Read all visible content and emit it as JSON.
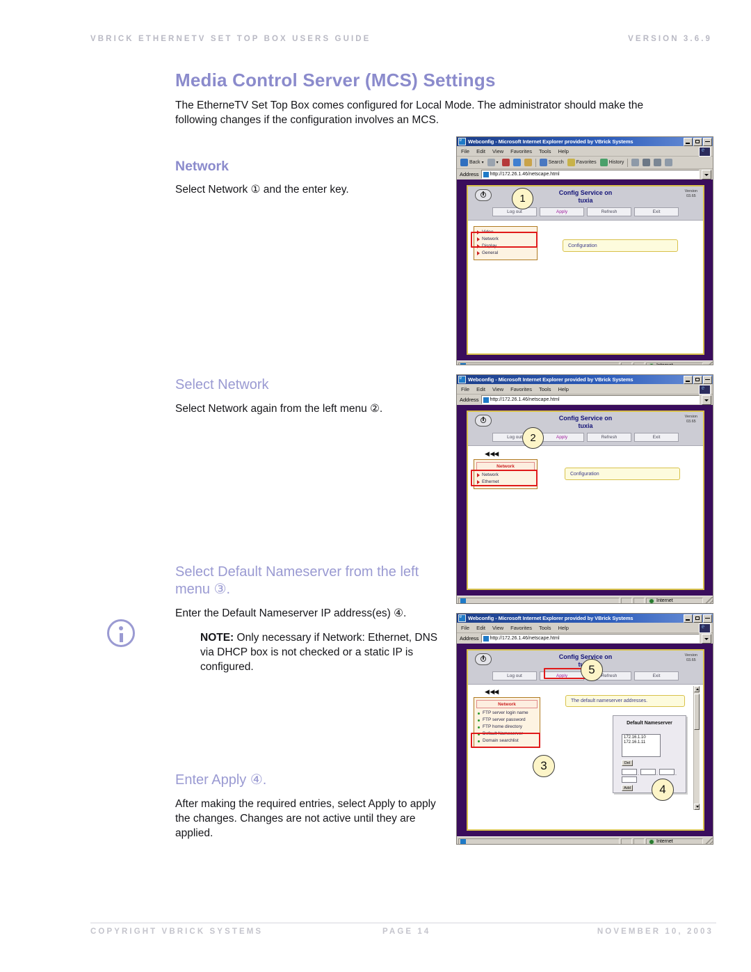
{
  "header": {
    "left": "VBRICK ETHERNETV SET TOP BOX USERS GUIDE",
    "right": "VERSION 3.6.9"
  },
  "footer": {
    "copyright": "COPYRIGHT VBRICK SYSTEMS",
    "page": "PAGE 14",
    "date": "NOVEMBER 10, 2003"
  },
  "doc": {
    "title": "Media Control Server (MCS) Settings",
    "intro": "The EtherneTV Set Top Box comes configured for Local Mode.  The administrator should make the following changes if the configuration involves an MCS.",
    "sections": {
      "network": {
        "heading": "Network",
        "body": "Select Network ① and the enter key."
      },
      "select_network": {
        "heading": "Select Network",
        "body": "Select Network again from the left menu ②."
      },
      "default_nameserver": {
        "heading": "Select Default Nameserver from the left menu ③.",
        "body": "Enter the Default Nameserver IP address(es) ④.",
        "note_label": "NOTE:",
        "note_body": "Only necessary if Network: Ethernet, DNS via DHCP box is not checked or a static IP is configured."
      },
      "enter_apply": {
        "heading": "Enter Apply ④.",
        "body": "After making the required entries, select Apply to apply the changes.  Changes are not active until they are applied."
      }
    }
  },
  "browser": {
    "title": "Webconfig - Microsoft Internet Explorer provided by VBrick Systems",
    "menu": [
      "File",
      "Edit",
      "View",
      "Favorites",
      "Tools",
      "Help"
    ],
    "toolbar": [
      "Back",
      "Forward",
      "Stop",
      "Refresh",
      "Home",
      "Search",
      "Favorites",
      "History",
      "Mail",
      "Print",
      "Edit",
      "Discuss"
    ],
    "address_label": "Address",
    "address_value": "http://172.26.1.46/netscape.html",
    "status_zone": "Internet"
  },
  "app": {
    "title_line1": "Config Service on",
    "title_line2": "tuxia",
    "version_label": "Version",
    "version_value": "03.65",
    "buttons": {
      "logout": "Log out",
      "apply": "Apply",
      "refresh": "Refresh",
      "exit": "Exit"
    },
    "content_label": "Configuration",
    "nameserver_tip": "The default nameserver addresses.",
    "menu_root": [
      "Video",
      "Network",
      "Display",
      "General"
    ],
    "menu_network_crumb": "Network",
    "menu_network": [
      "Network",
      "Ethernet"
    ],
    "menu_ns_crumb": "Network",
    "menu_ns": [
      "FTP server login name",
      "FTP server password",
      "FTP home directory",
      "Default Nameserver",
      "Domain searchlist"
    ],
    "nameserver_panel": {
      "title": "Default Nameserver",
      "entries": [
        "172.16.1.10",
        "172.16.1.11"
      ],
      "del_label": "Del",
      "add_label": "Add"
    },
    "back_arrows": "◀ ◀◀"
  },
  "callouts": {
    "c1": "1",
    "c2": "2",
    "c3": "3",
    "c4": "4",
    "c5": "5"
  },
  "colors": {
    "heading": "#8b8bcc",
    "heading_light": "#9a9ad2",
    "app_viewport": "#3a0d5c",
    "callout_fill": "#fdf5c8",
    "highlight_red": "#e01a1a"
  }
}
